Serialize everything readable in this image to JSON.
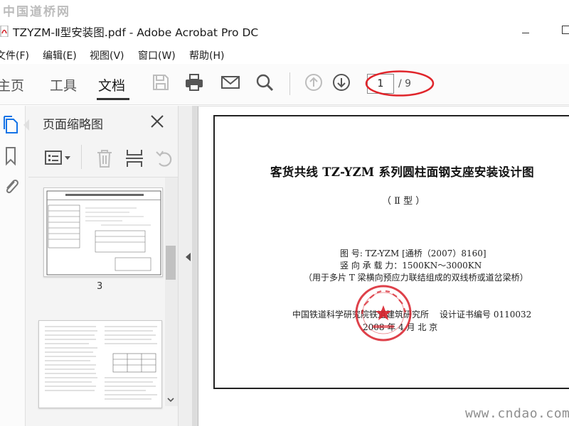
{
  "watermark_top": "中国道桥网",
  "watermark_bottom": "www.cndao.com",
  "window": {
    "title": "TZYZM-Ⅱ型安装图.pdf - Adobe Acrobat Pro DC"
  },
  "menu": [
    "文件(F)",
    "编辑(E)",
    "视图(V)",
    "窗口(W)",
    "帮助(H)"
  ],
  "tabs": {
    "home": "主页",
    "tools": "工具",
    "document": "文档"
  },
  "toolbar_icons": [
    "save-icon",
    "print-icon",
    "email-icon",
    "search-icon",
    "page-up-icon",
    "page-down-icon"
  ],
  "page_nav": {
    "current": "1",
    "total": "/ 9"
  },
  "thumbnails": {
    "title": "页面缩略图",
    "current_label": "3"
  },
  "document": {
    "title": "客货共线 TZ-YZM  系列圆柱面钢支座安装设计图",
    "subtitle": "（  Ⅱ    型  ）",
    "drawing_no": "图     号:     TZ-YZM [通桥（2007）8160]",
    "capacity": "竖   向   承   载   力：1500KN～3000KN",
    "usage": "（用于多片 T 梁横向预应力联结组成的双线桥或道岔梁桥）",
    "institute": "中国铁道科学研究院铁道建筑研究所",
    "cert": "设计证书编号  0110032",
    "date": "2008   年   4   月          北    京"
  },
  "colors": {
    "annotation": "#e0252b",
    "seal": "#d8202a"
  }
}
